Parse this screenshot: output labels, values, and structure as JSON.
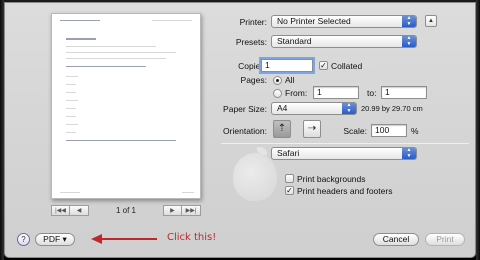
{
  "printer": {
    "label": "Printer:",
    "value": "No Printer Selected"
  },
  "presets": {
    "label": "Presets:",
    "value": "Standard"
  },
  "copies": {
    "label": "Copies:",
    "value": "1",
    "collated_label": "Collated",
    "collated_checked": true
  },
  "pages": {
    "label": "Pages:",
    "all_label": "All",
    "from_label": "From:",
    "from_value": "1",
    "to_label": "to:",
    "to_value": "1"
  },
  "paper_size": {
    "label": "Paper Size:",
    "value": "A4",
    "dimensions": "20.99 by 29.70 cm"
  },
  "orientation": {
    "label": "Orientation:",
    "portrait_icon": "portrait-orientation-icon",
    "landscape_icon": "landscape-orientation-icon"
  },
  "scale": {
    "label": "Scale:",
    "value": "100",
    "unit": "%"
  },
  "app_section": {
    "value": "Safari"
  },
  "options": {
    "print_backgrounds": "Print backgrounds",
    "print_backgrounds_checked": false,
    "print_headers_footers": "Print headers and footers",
    "print_headers_footers_checked": true
  },
  "preview": {
    "page_label": "1 of 1"
  },
  "bottom": {
    "help": "?",
    "pdf_label": "PDF ▾",
    "cancel_label": "Cancel",
    "print_label": "Print"
  },
  "callout": {
    "text": "Click this!"
  },
  "colors": {
    "accent": "#2c5bc8",
    "callout": "#c2262a"
  }
}
